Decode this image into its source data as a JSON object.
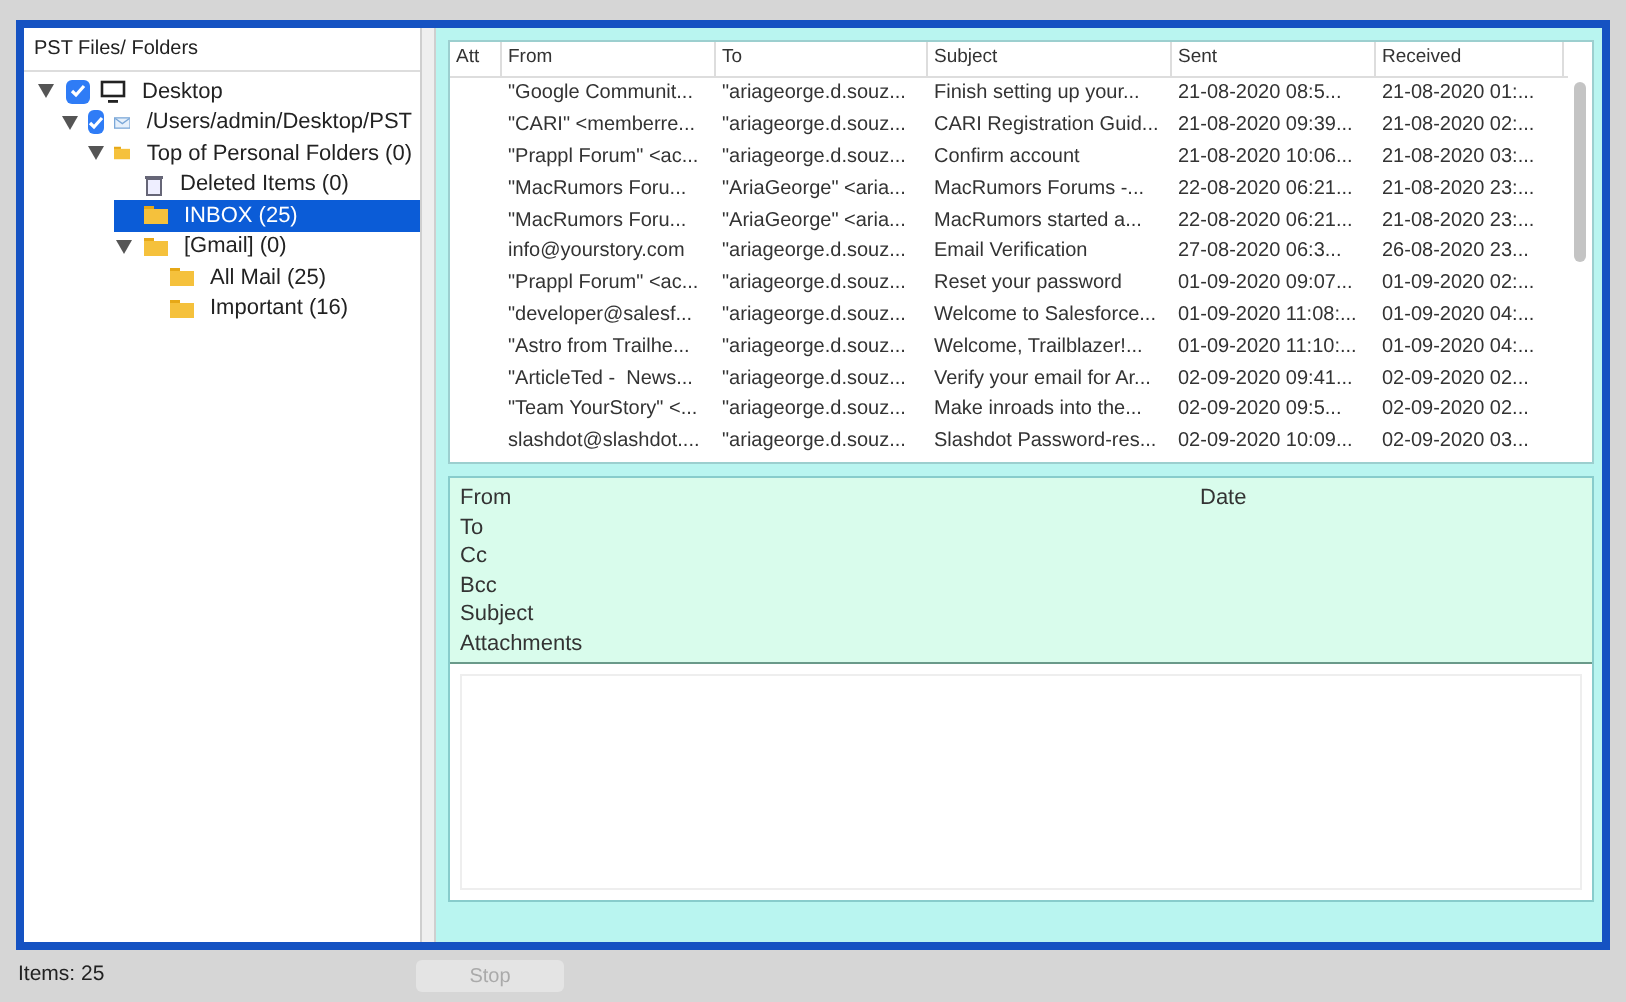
{
  "sidebar": {
    "title": "PST Files/ Folders",
    "tree": [
      {
        "label": "Desktop",
        "kind": "desktop",
        "checked": true,
        "expanded": true,
        "selected": false,
        "children": [
          {
            "label": "/Users/admin/Desktop/PST",
            "kind": "pst",
            "checked": true,
            "expanded": true,
            "selected": false,
            "children": [
              {
                "label": "Top of Personal Folders (0)",
                "kind": "folder",
                "expanded": true,
                "selected": false,
                "children": [
                  {
                    "label": "Deleted Items (0)",
                    "kind": "trash",
                    "selected": false
                  },
                  {
                    "label": "INBOX (25)",
                    "kind": "folder",
                    "selected": true
                  },
                  {
                    "label": "[Gmail] (0)",
                    "kind": "folder",
                    "expanded": true,
                    "selected": false,
                    "children": [
                      {
                        "label": "All Mail (25)",
                        "kind": "folder",
                        "selected": false
                      },
                      {
                        "label": "Important (16)",
                        "kind": "folder",
                        "selected": false
                      }
                    ]
                  }
                ]
              }
            ]
          }
        ]
      }
    ]
  },
  "table": {
    "columns": [
      "Att",
      "From",
      "To",
      "Subject",
      "Sent",
      "Received"
    ],
    "rows": [
      [
        "",
        "\"Google Communit...",
        "\"ariageorge.d.souz...",
        "Finish setting up your...",
        "21-08-2020 08:5...",
        "21-08-2020 01:..."
      ],
      [
        "",
        "\"CARI\" <memberre...",
        "\"ariageorge.d.souz...",
        "CARI Registration Guid...",
        "21-08-2020 09:39...",
        "21-08-2020 02:..."
      ],
      [
        "",
        "\"Prappl Forum\" <ac...",
        "\"ariageorge.d.souz...",
        "Confirm account",
        "21-08-2020 10:06...",
        "21-08-2020 03:..."
      ],
      [
        "",
        "\"MacRumors Foru...",
        "\"AriaGeorge\" <aria...",
        "MacRumors Forums -...",
        "22-08-2020 06:21...",
        "21-08-2020 23:..."
      ],
      [
        "",
        "\"MacRumors Foru...",
        "\"AriaGeorge\" <aria...",
        "MacRumors started a...",
        "22-08-2020 06:21...",
        "21-08-2020 23:..."
      ],
      [
        "",
        "info@yourstory.com",
        "\"ariageorge.d.souz...",
        "Email Verification",
        "27-08-2020 06:3...",
        "26-08-2020 23..."
      ],
      [
        "",
        "\"Prappl Forum\" <ac...",
        "\"ariageorge.d.souz...",
        "Reset your password",
        "01-09-2020 09:07...",
        "01-09-2020 02:..."
      ],
      [
        "",
        "\"developer@salesf...",
        "\"ariageorge.d.souz...",
        "Welcome to Salesforce...",
        "01-09-2020 11:08:...",
        "01-09-2020 04:..."
      ],
      [
        "",
        "\"Astro from Trailhe...",
        "\"ariageorge.d.souz...",
        "Welcome, Trailblazer!...",
        "01-09-2020 11:10:...",
        "01-09-2020 04:..."
      ],
      [
        "",
        "\"ArticleTed -  News...",
        "\"ariageorge.d.souz...",
        "Verify your email for Ar...",
        "02-09-2020 09:41...",
        "02-09-2020 02..."
      ],
      [
        "",
        "\"Team YourStory\" <...",
        "\"ariageorge.d.souz...",
        "Make inroads into the...",
        "02-09-2020 09:5...",
        "02-09-2020 02..."
      ],
      [
        "",
        "slashdot@slashdot....",
        "\"ariageorge.d.souz...",
        "Slashdot Password-res...",
        "02-09-2020 10:09...",
        "02-09-2020 03..."
      ]
    ]
  },
  "preview": {
    "fields": [
      "From",
      "To",
      "Cc",
      "Bcc",
      "Subject",
      "Attachments"
    ],
    "date_label": "Date"
  },
  "status_bar": {
    "items": "Items: 25",
    "stop_button": {
      "label": "Stop",
      "disabled": true
    }
  }
}
